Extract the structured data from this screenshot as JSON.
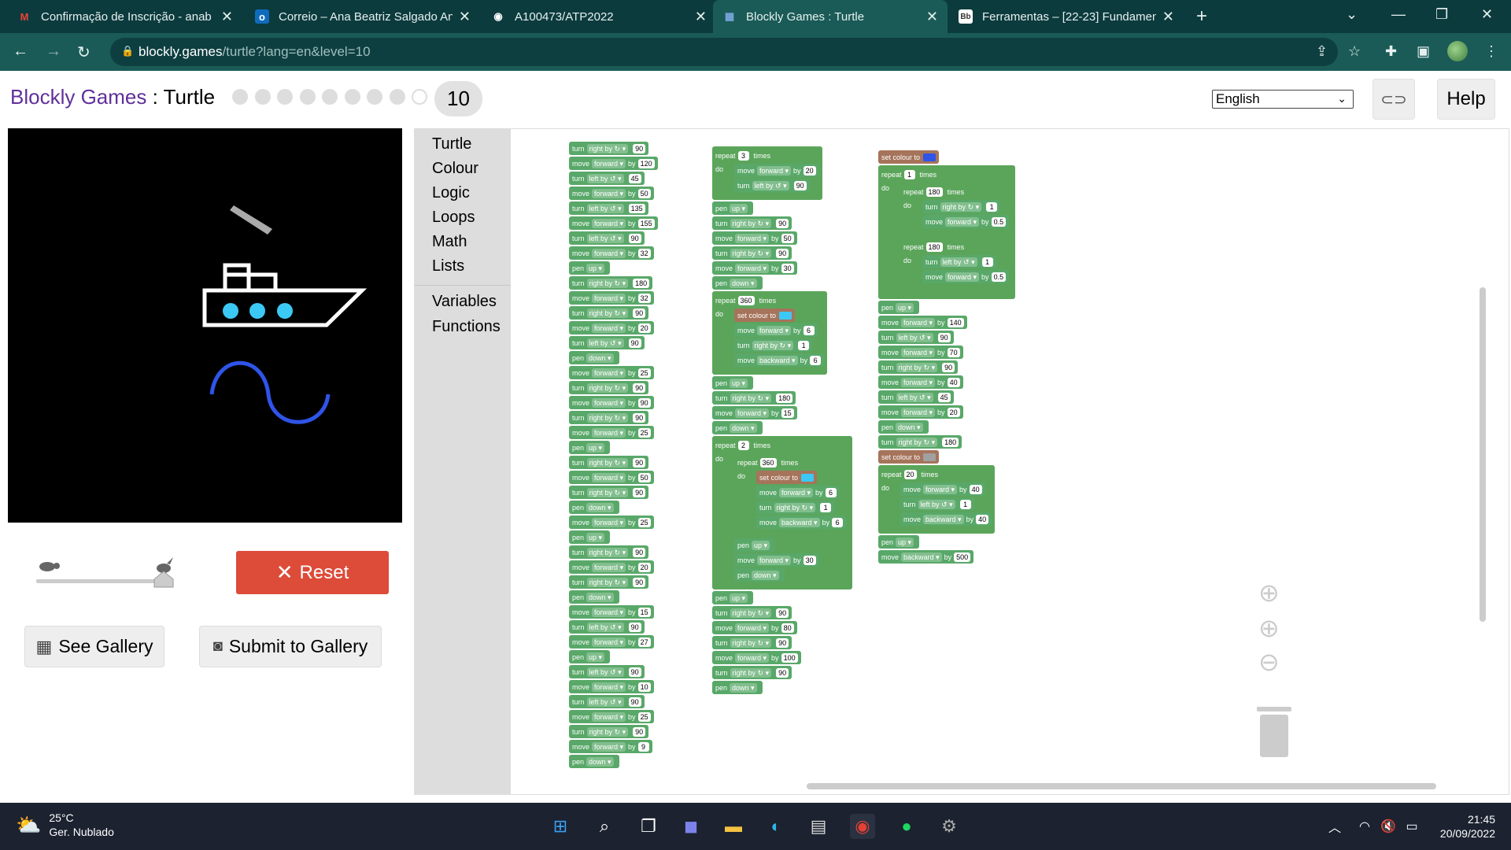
{
  "browser": {
    "tabs": [
      {
        "title": "Confirmação de Inscrição - anab",
        "favicon": "M",
        "favicon_color": "#ea4335",
        "active": false
      },
      {
        "title": "Correio – Ana Beatriz Salgado An",
        "favicon": "o",
        "favicon_color": "#0f6cbd",
        "active": false
      },
      {
        "title": "A100473/ATP2022",
        "favicon": "◉",
        "favicon_color": "#ffffff",
        "active": false
      },
      {
        "title": "Blockly Games : Turtle",
        "favicon": "▦",
        "favicon_color": "#7aa7e0",
        "active": true
      },
      {
        "title": "Ferramentas – [22-23] Fundamen",
        "favicon": "Bb",
        "favicon_color": "#444444",
        "active": false
      }
    ],
    "url_host": "blockly.games",
    "url_path": "/turtle?lang=en&level=10"
  },
  "page": {
    "brand": "Blockly Games",
    "separator": " : ",
    "app": "Turtle",
    "level": "10",
    "language": "English",
    "help_label": "Help"
  },
  "controls": {
    "reset_label": "Reset",
    "see_gallery_label": "See Gallery",
    "submit_gallery_label": "Submit to Gallery"
  },
  "toolbox": {
    "categories": [
      "Turtle",
      "Colour",
      "Logic",
      "Loops",
      "Math",
      "Lists"
    ],
    "categories2": [
      "Variables",
      "Functions"
    ]
  },
  "code": {
    "labels": {
      "turn": "turn",
      "right_by": "right by ↻",
      "left_by": "left by ↺",
      "move": "move",
      "forward": "forward",
      "backward": "backward",
      "by": "by",
      "pen": "pen",
      "up": "up",
      "down": "down",
      "repeat": "repeat",
      "times": "times",
      "do": "do",
      "set_colour_to": "set colour to"
    },
    "colours": {
      "blue": "#2f54e8",
      "cyan": "#3cc8f5",
      "grey": "#a0a0a0"
    }
  },
  "taskbar": {
    "temperature": "25°C",
    "weather": "Ger. Nublado",
    "time": "21:45",
    "date": "20/09/2022"
  }
}
